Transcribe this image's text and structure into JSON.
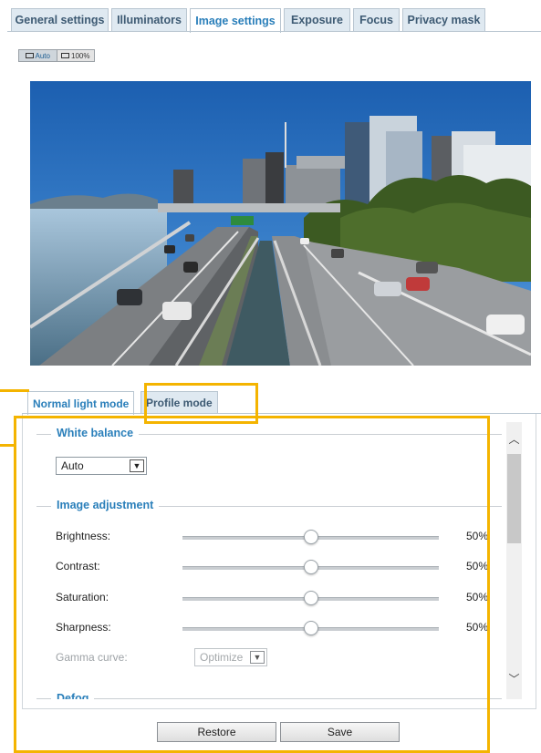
{
  "top_tabs": [
    {
      "label": "General settings",
      "active": false
    },
    {
      "label": "Illuminators",
      "active": false
    },
    {
      "label": "Image settings",
      "active": true
    },
    {
      "label": "Exposure",
      "active": false
    },
    {
      "label": "Focus",
      "active": false
    },
    {
      "label": "Privacy mask",
      "active": false
    }
  ],
  "zoom": {
    "auto_label": "Auto",
    "full_label": "100%"
  },
  "mode_tabs": [
    {
      "label": "Normal light mode",
      "active": true
    },
    {
      "label": "Profile mode",
      "active": false
    }
  ],
  "white_balance": {
    "title": "White balance",
    "value": "Auto"
  },
  "image_adjustment": {
    "title": "Image adjustment",
    "rows": [
      {
        "label": "Brightness:",
        "value": "50%",
        "level": 0.5
      },
      {
        "label": "Contrast:",
        "value": "50%",
        "level": 0.5
      },
      {
        "label": "Saturation:",
        "value": "50%",
        "level": 0.5
      },
      {
        "label": "Sharpness:",
        "value": "50%",
        "level": 0.5
      }
    ],
    "gamma": {
      "label": "Gamma curve:",
      "value": "Optimize"
    }
  },
  "defog": {
    "title": "Defog"
  },
  "buttons": {
    "restore": "Restore",
    "save": "Save"
  },
  "colors": {
    "accent": "#2a7fba",
    "highlight": "#f4b400",
    "tab_bg": "#dfe9f1"
  }
}
